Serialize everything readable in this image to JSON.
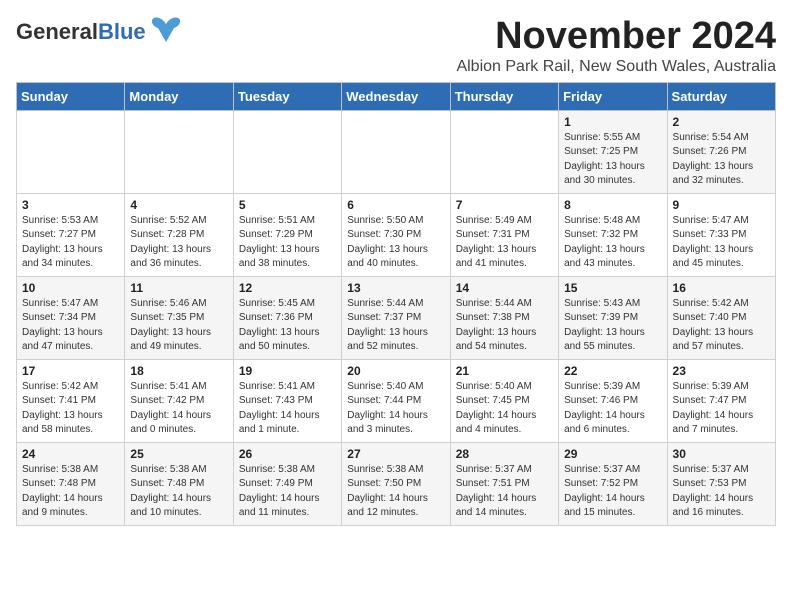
{
  "logo": {
    "general": "General",
    "blue": "Blue"
  },
  "title": "November 2024",
  "location": "Albion Park Rail, New South Wales, Australia",
  "headers": [
    "Sunday",
    "Monday",
    "Tuesday",
    "Wednesday",
    "Thursday",
    "Friday",
    "Saturday"
  ],
  "weeks": [
    [
      {
        "day": "",
        "content": ""
      },
      {
        "day": "",
        "content": ""
      },
      {
        "day": "",
        "content": ""
      },
      {
        "day": "",
        "content": ""
      },
      {
        "day": "",
        "content": ""
      },
      {
        "day": "1",
        "content": "Sunrise: 5:55 AM\nSunset: 7:25 PM\nDaylight: 13 hours\nand 30 minutes."
      },
      {
        "day": "2",
        "content": "Sunrise: 5:54 AM\nSunset: 7:26 PM\nDaylight: 13 hours\nand 32 minutes."
      }
    ],
    [
      {
        "day": "3",
        "content": "Sunrise: 5:53 AM\nSunset: 7:27 PM\nDaylight: 13 hours\nand 34 minutes."
      },
      {
        "day": "4",
        "content": "Sunrise: 5:52 AM\nSunset: 7:28 PM\nDaylight: 13 hours\nand 36 minutes."
      },
      {
        "day": "5",
        "content": "Sunrise: 5:51 AM\nSunset: 7:29 PM\nDaylight: 13 hours\nand 38 minutes."
      },
      {
        "day": "6",
        "content": "Sunrise: 5:50 AM\nSunset: 7:30 PM\nDaylight: 13 hours\nand 40 minutes."
      },
      {
        "day": "7",
        "content": "Sunrise: 5:49 AM\nSunset: 7:31 PM\nDaylight: 13 hours\nand 41 minutes."
      },
      {
        "day": "8",
        "content": "Sunrise: 5:48 AM\nSunset: 7:32 PM\nDaylight: 13 hours\nand 43 minutes."
      },
      {
        "day": "9",
        "content": "Sunrise: 5:47 AM\nSunset: 7:33 PM\nDaylight: 13 hours\nand 45 minutes."
      }
    ],
    [
      {
        "day": "10",
        "content": "Sunrise: 5:47 AM\nSunset: 7:34 PM\nDaylight: 13 hours\nand 47 minutes."
      },
      {
        "day": "11",
        "content": "Sunrise: 5:46 AM\nSunset: 7:35 PM\nDaylight: 13 hours\nand 49 minutes."
      },
      {
        "day": "12",
        "content": "Sunrise: 5:45 AM\nSunset: 7:36 PM\nDaylight: 13 hours\nand 50 minutes."
      },
      {
        "day": "13",
        "content": "Sunrise: 5:44 AM\nSunset: 7:37 PM\nDaylight: 13 hours\nand 52 minutes."
      },
      {
        "day": "14",
        "content": "Sunrise: 5:44 AM\nSunset: 7:38 PM\nDaylight: 13 hours\nand 54 minutes."
      },
      {
        "day": "15",
        "content": "Sunrise: 5:43 AM\nSunset: 7:39 PM\nDaylight: 13 hours\nand 55 minutes."
      },
      {
        "day": "16",
        "content": "Sunrise: 5:42 AM\nSunset: 7:40 PM\nDaylight: 13 hours\nand 57 minutes."
      }
    ],
    [
      {
        "day": "17",
        "content": "Sunrise: 5:42 AM\nSunset: 7:41 PM\nDaylight: 13 hours\nand 58 minutes."
      },
      {
        "day": "18",
        "content": "Sunrise: 5:41 AM\nSunset: 7:42 PM\nDaylight: 14 hours\nand 0 minutes."
      },
      {
        "day": "19",
        "content": "Sunrise: 5:41 AM\nSunset: 7:43 PM\nDaylight: 14 hours\nand 1 minute."
      },
      {
        "day": "20",
        "content": "Sunrise: 5:40 AM\nSunset: 7:44 PM\nDaylight: 14 hours\nand 3 minutes."
      },
      {
        "day": "21",
        "content": "Sunrise: 5:40 AM\nSunset: 7:45 PM\nDaylight: 14 hours\nand 4 minutes."
      },
      {
        "day": "22",
        "content": "Sunrise: 5:39 AM\nSunset: 7:46 PM\nDaylight: 14 hours\nand 6 minutes."
      },
      {
        "day": "23",
        "content": "Sunrise: 5:39 AM\nSunset: 7:47 PM\nDaylight: 14 hours\nand 7 minutes."
      }
    ],
    [
      {
        "day": "24",
        "content": "Sunrise: 5:38 AM\nSunset: 7:48 PM\nDaylight: 14 hours\nand 9 minutes."
      },
      {
        "day": "25",
        "content": "Sunrise: 5:38 AM\nSunset: 7:48 PM\nDaylight: 14 hours\nand 10 minutes."
      },
      {
        "day": "26",
        "content": "Sunrise: 5:38 AM\nSunset: 7:49 PM\nDaylight: 14 hours\nand 11 minutes."
      },
      {
        "day": "27",
        "content": "Sunrise: 5:38 AM\nSunset: 7:50 PM\nDaylight: 14 hours\nand 12 minutes."
      },
      {
        "day": "28",
        "content": "Sunrise: 5:37 AM\nSunset: 7:51 PM\nDaylight: 14 hours\nand 14 minutes."
      },
      {
        "day": "29",
        "content": "Sunrise: 5:37 AM\nSunset: 7:52 PM\nDaylight: 14 hours\nand 15 minutes."
      },
      {
        "day": "30",
        "content": "Sunrise: 5:37 AM\nSunset: 7:53 PM\nDaylight: 14 hours\nand 16 minutes."
      }
    ]
  ]
}
